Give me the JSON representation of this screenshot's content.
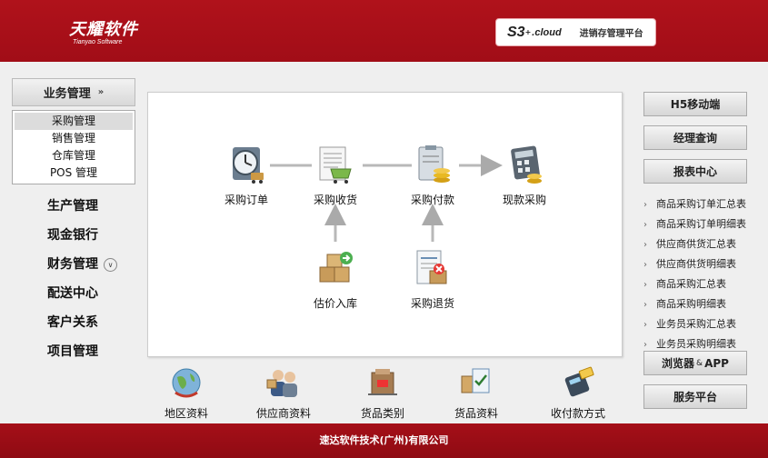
{
  "header": {
    "logo_cn": "天耀软件",
    "logo_en": "Tianyao Software",
    "badge_s3": "S3",
    "badge_sup": "+",
    "badge_cloud": ".cloud",
    "badge_platform": "进销存管理平台"
  },
  "nav": {
    "head_label": "业务管理",
    "submenu": [
      {
        "label": "采购管理",
        "active": true
      },
      {
        "label": "销售管理",
        "active": false
      },
      {
        "label": "仓库管理",
        "active": false
      },
      {
        "label": "POS 管理",
        "active": false
      }
    ],
    "items": [
      "生产管理",
      "现金银行",
      "财务管理",
      "配送中心",
      "客户关系",
      "项目管理"
    ]
  },
  "flow": {
    "purchase_order": "采购订单",
    "purchase_receive": "采购收货",
    "purchase_payment": "采购付款",
    "cash_purchase": "现款采购",
    "estimate_stockin": "估价入库",
    "purchase_return": "采购退货"
  },
  "bottom": [
    "地区资料",
    "供应商资料",
    "货品类别",
    "货品资料",
    "收付款方式"
  ],
  "right": {
    "h5": "H5移动端",
    "manager": "经理查询",
    "report_center": "报表中心",
    "reports": [
      "商品采购订单汇总表",
      "商品采购订单明细表",
      "供应商供货汇总表",
      "供应商供货明细表",
      "商品采购汇总表",
      "商品采购明细表",
      "业务员采购汇总表",
      "业务员采购明细表"
    ],
    "browser_a": "浏览器",
    "browser_amp": "&",
    "browser_b": "APP",
    "service": "服务平台"
  },
  "footer": {
    "text": "速达软件技术(广州)有限公司"
  },
  "colors": {
    "brand_red": "#a10d17",
    "panel_bg": "#ffffff",
    "page_bg": "#efefef"
  }
}
